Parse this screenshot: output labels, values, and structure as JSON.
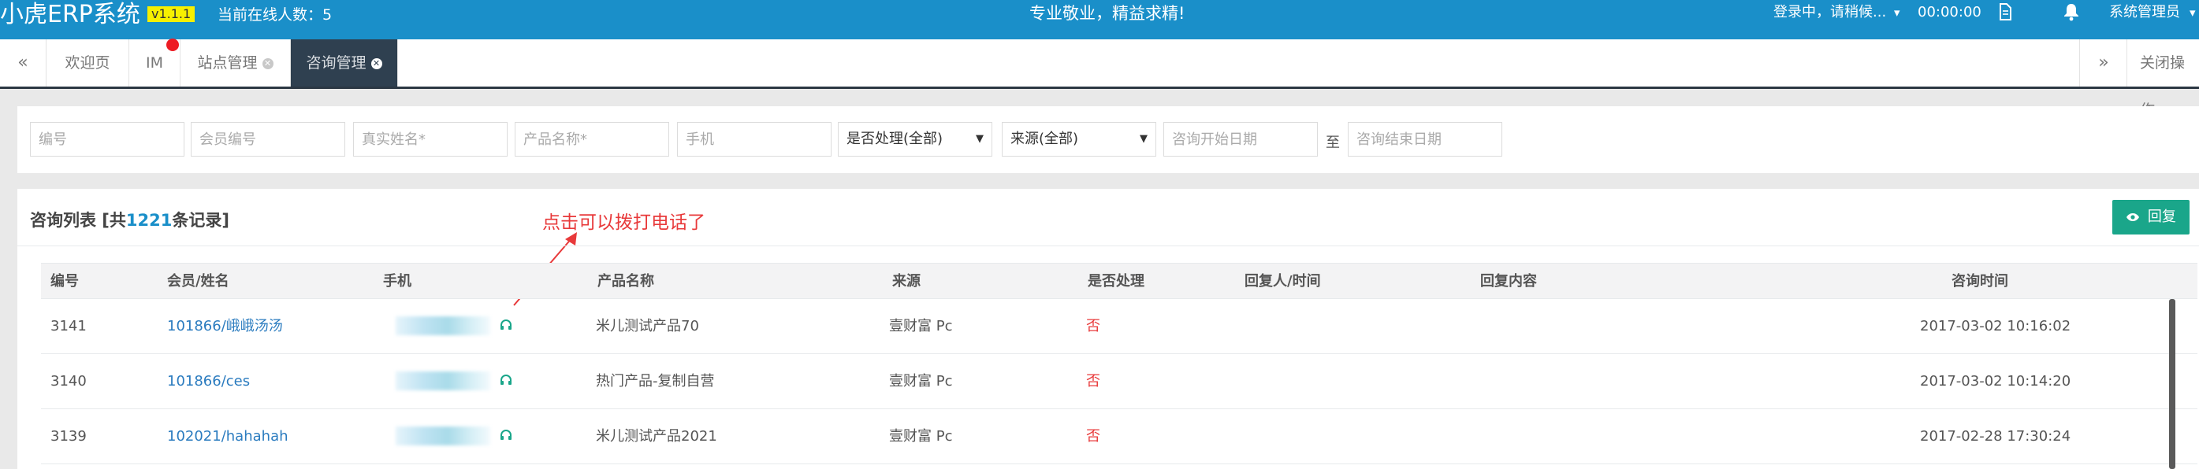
{
  "header": {
    "brand": "小虎ERP系统",
    "version": "v1.1.1",
    "online_count": "当前在线人数：5",
    "slogan": "专业敬业，精益求精!",
    "login_status": "登录中，请稍候...",
    "clock": "00:00:00",
    "admin": "系统管理员"
  },
  "tabs": {
    "prev": "«",
    "next": "»",
    "items": [
      {
        "label": "欢迎页"
      },
      {
        "label": "IM"
      },
      {
        "label": "站点管理"
      },
      {
        "label": "咨询管理"
      }
    ],
    "close_ops": "关闭操作"
  },
  "filters": {
    "id": "编号",
    "member_id": "会员编号",
    "real_name": "真实姓名*",
    "product_name": "产品名称*",
    "phone": "手机",
    "processed": "是否处理(全部)",
    "source": "来源(全部)",
    "start_date": "咨询开始日期",
    "to": "至",
    "end_date": "咨询结束日期"
  },
  "list": {
    "title_prefix": "咨询列表 [共",
    "total": "1221",
    "title_suffix": "条记录]",
    "annotation": "点击可以拨打电话了",
    "reply_button": "回复"
  },
  "table": {
    "headers": [
      "编号",
      "会员/姓名",
      "手机",
      "产品名称",
      "来源",
      "是否处理",
      "回复人/时间",
      "回复内容",
      "咨询时间"
    ],
    "rows": [
      {
        "id": "3141",
        "member": "101866/峨峨汤汤",
        "product": "米儿测试产品70",
        "source": "壹财富 Pc",
        "processed": "否",
        "replier": "",
        "reply": "",
        "time": "2017-03-02 10:16:02"
      },
      {
        "id": "3140",
        "member": "101866/ces",
        "product": "热门产品-复制自营",
        "source": "壹财富 Pc",
        "processed": "否",
        "replier": "",
        "reply": "",
        "time": "2017-03-02 10:14:20"
      },
      {
        "id": "3139",
        "member": "102021/hahahah",
        "product": "米儿测试产品2021",
        "source": "壹财富 Pc",
        "processed": "否",
        "replier": "",
        "reply": "",
        "time": "2017-02-28 17:30:24"
      }
    ]
  },
  "colors": {
    "header_bg": "#1a8fc9",
    "active_tab_bg": "#2f4050",
    "reply_button_bg": "#1aa68a",
    "link": "#2a7bbf",
    "alert_red": "#e8393a",
    "version_badge": "#f7f000"
  }
}
